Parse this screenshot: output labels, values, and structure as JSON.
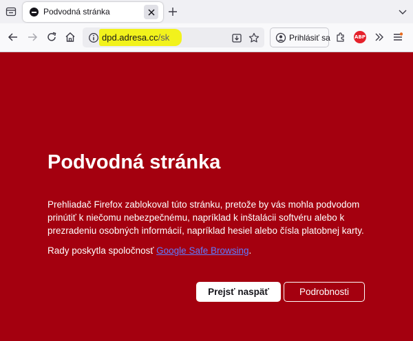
{
  "tab": {
    "title": "Podvodná stránka"
  },
  "urlbar": {
    "host": "dpd.adresa.cc",
    "path": "/sk",
    "highlight_color": "#f2f21c"
  },
  "toolbar": {
    "signin_label": "Prihlásiť sa",
    "adblock_label": "ABP"
  },
  "page": {
    "title": "Podvodná stránka",
    "description": "Prehliadač Firefox zablokoval túto stránku, pretože by vás mohla podvodom prinútiť k niečomu nebezpečnému, napríklad k inštalácii softvéru alebo k prezradeniu osobných informácií, napríklad hesiel alebo čísla platobnej karty.",
    "advisory_prefix": "Rady poskytla spoločnosť ",
    "advisory_link": "Google Safe Browsing",
    "advisory_suffix": ".",
    "go_back_label": "Prejsť naspäť",
    "details_label": "Podrobnosti"
  },
  "colors": {
    "warning_background": "#a4000f",
    "link": "#5f7bff"
  },
  "icons": [
    "tab-list-icon",
    "deceptive-site-icon",
    "close-icon",
    "plus-icon",
    "chevron-down-icon",
    "back-icon",
    "forward-icon",
    "reload-icon",
    "home-icon",
    "site-info-icon",
    "download-page-icon",
    "star-icon",
    "account-icon",
    "extensions-icon",
    "adblock-icon",
    "overflow-icon",
    "menu-icon"
  ]
}
